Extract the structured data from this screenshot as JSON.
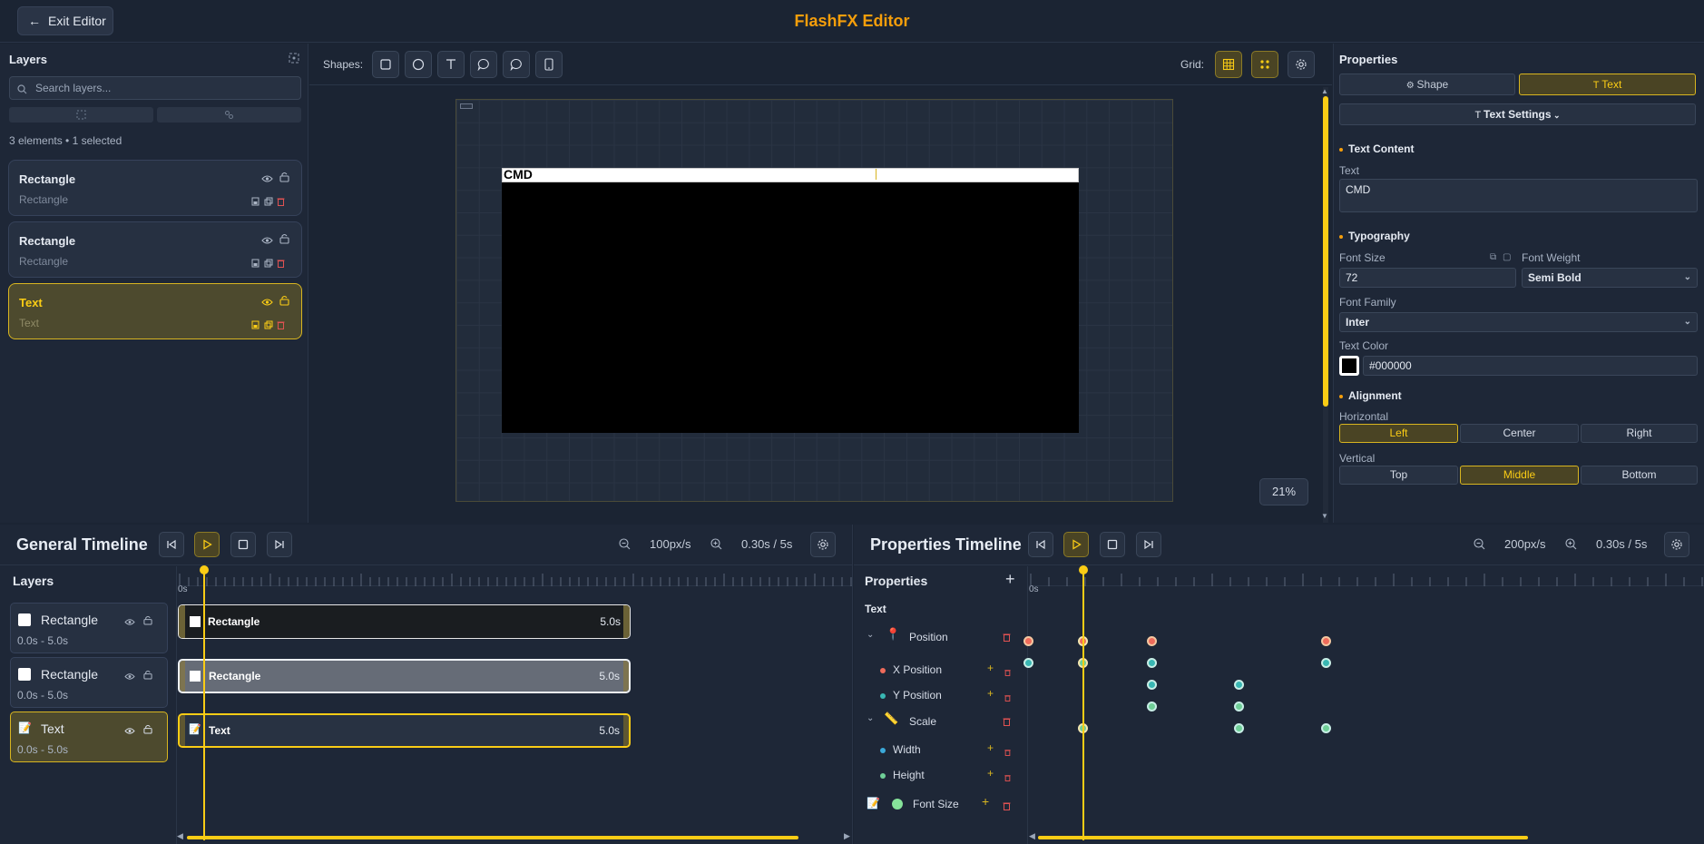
{
  "header": {
    "exit_label": "Exit Editor",
    "title": "FlashFX Editor"
  },
  "layers_panel": {
    "title": "Layers",
    "search_placeholder": "Search layers...",
    "summary": "3 elements • 1 selected",
    "items": [
      {
        "name": "Rectangle",
        "type": "Rectangle",
        "selected": false
      },
      {
        "name": "Rectangle",
        "type": "Rectangle",
        "selected": false
      },
      {
        "name": "Text",
        "type": "Text",
        "selected": true
      }
    ]
  },
  "canvas": {
    "shapes_label": "Shapes:",
    "grid_label": "Grid:",
    "text_content": "CMD",
    "zoom": "21%"
  },
  "properties": {
    "title": "Properties",
    "tabs": [
      "Shape",
      "Text"
    ],
    "active_tab": "Text",
    "settings_label": "Text Settings",
    "text_content_section": "Text Content",
    "text_label": "Text",
    "text_value": "CMD",
    "typography_section": "Typography",
    "font_size_label": "Font Size",
    "font_size_value": "72",
    "font_weight_label": "Font Weight",
    "font_weight_value": "Semi Bold",
    "font_family_label": "Font Family",
    "font_family_value": "Inter",
    "text_color_label": "Text Color",
    "text_color_value": "#000000",
    "alignment_section": "Alignment",
    "horizontal_label": "Horizontal",
    "horizontal_options": [
      "Left",
      "Center",
      "Right"
    ],
    "horizontal_selected": "Left",
    "vertical_label": "Vertical",
    "vertical_options": [
      "Top",
      "Middle",
      "Bottom"
    ],
    "vertical_selected": "Middle"
  },
  "general_timeline": {
    "title": "General Timeline",
    "zoom": "100px/s",
    "time": "0.30s / 5s",
    "layers_label": "Layers",
    "start_tick": "0s",
    "layers": [
      {
        "name": "Rectangle",
        "range": "0.0s - 5.0s",
        "duration": "5.0s"
      },
      {
        "name": "Rectangle",
        "range": "0.0s - 5.0s",
        "duration": "5.0s"
      },
      {
        "name": "Text",
        "range": "0.0s - 5.0s",
        "duration": "5.0s"
      }
    ]
  },
  "properties_timeline": {
    "title": "Properties Timeline",
    "zoom": "200px/s",
    "time": "0.30s / 5s",
    "properties_label": "Properties",
    "start_tick": "0s",
    "element": "Text",
    "groups": {
      "position": "Position",
      "x_position": "X Position",
      "y_position": "Y Position",
      "scale": "Scale",
      "width": "Width",
      "height": "Height",
      "font_size": "Font Size"
    }
  },
  "colors": {
    "accent": "#facc15",
    "title": "#f59e0b",
    "bg": "#1b2433",
    "panel": "#1e2737"
  }
}
